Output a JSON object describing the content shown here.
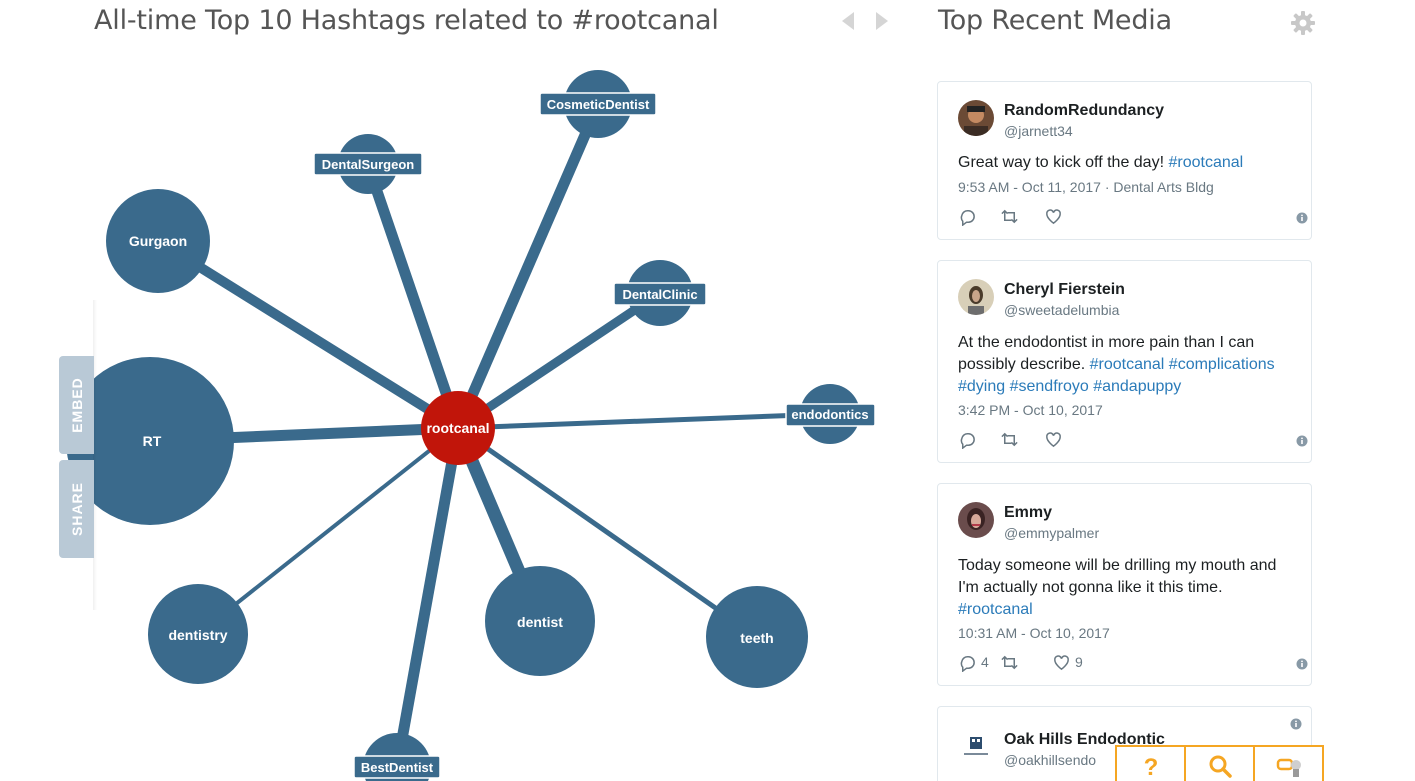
{
  "chart": {
    "title": "All-time Top 10 Hashtags related to #rootcanal",
    "center": "rootcanal",
    "nodes": [
      {
        "label": "RT"
      },
      {
        "label": "Gurgaon"
      },
      {
        "label": "DentalSurgeon"
      },
      {
        "label": "CosmeticDentist"
      },
      {
        "label": "DentalClinic"
      },
      {
        "label": "endodontics"
      },
      {
        "label": "teeth"
      },
      {
        "label": "dentist"
      },
      {
        "label": "BestDentist"
      },
      {
        "label": "dentistry"
      }
    ]
  },
  "side_tabs": {
    "embed": "EMBED",
    "share": "SHARE"
  },
  "media": {
    "title": "Top Recent Media",
    "tweets": [
      {
        "name": "RandomRedundancy",
        "handle": "@jarnett34",
        "text_plain": "Great way to kick off the day! ",
        "tags": "#rootcanal",
        "meta": "9:53 AM - Oct 11, 2017 · Dental Arts Bldg",
        "replies": "",
        "retweets": "",
        "likes": ""
      },
      {
        "name": "Cheryl Fierstein",
        "handle": "@sweetadelumbia",
        "text_plain": "At the endodontist in more pain than I can possibly describe. ",
        "tags": "#rootcanal #complications #dying #sendfroyo #andapuppy",
        "meta": "3:42 PM - Oct 10, 2017",
        "replies": "",
        "retweets": "",
        "likes": ""
      },
      {
        "name": "Emmy",
        "handle": "@emmypalmer",
        "text_plain": "Today someone will be drilling my mouth and I'm actually not gonna like it this time. ",
        "tags": "#rootcanal",
        "meta": "10:31 AM - Oct 10, 2017",
        "replies": "4",
        "retweets": "",
        "likes": "9"
      },
      {
        "name": "Oak Hills Endodontic",
        "handle": "@oakhillsendo"
      }
    ]
  },
  "colors": {
    "node": "#3a6a8c",
    "center": "#c1150a",
    "accent": "#f5a623",
    "link": "#2b7bb9"
  },
  "toolbar": {
    "help_icon": "question-icon",
    "search_icon": "search-icon",
    "chat_icon": "chat-icon"
  }
}
